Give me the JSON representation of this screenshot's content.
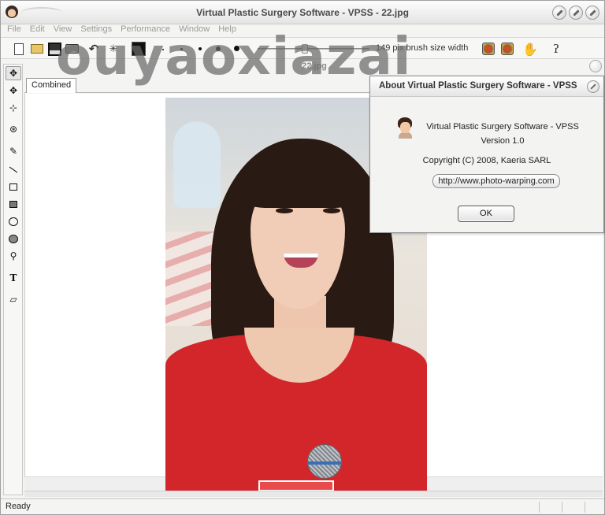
{
  "window": {
    "title": "Virtual Plastic Surgery Software - VPSS - 22.jpg"
  },
  "menu": {
    "items": [
      "File",
      "Edit",
      "View",
      "Settings",
      "Performance",
      "Window",
      "Help"
    ]
  },
  "toolbar": {
    "brush_size_label": "149 pix brush size width",
    "brush_size": 149,
    "brush_size_slider_fraction": 0.42,
    "icons": [
      "new-file-icon",
      "open-folder-icon",
      "save-icon",
      "print-icon",
      "undo-icon",
      "sparkle-icon",
      "color-swatch-icon",
      "brush-size-dots",
      "record-icon",
      "record-icon",
      "hand-icon",
      "help-icon"
    ],
    "active_color": "#111111"
  },
  "tools": {
    "icons": [
      "move-all-icon",
      "move-icon",
      "expand-icon",
      "shrink-icon",
      "pencil-icon",
      "line-icon",
      "rectangle-icon",
      "filled-rectangle-icon",
      "ellipse-icon",
      "filled-ellipse-icon",
      "eyedropper-icon",
      "text-icon",
      "eraser-icon"
    ],
    "text_tool_glyph": "T"
  },
  "document": {
    "title": "22.jpg",
    "tabs": [
      "Combined"
    ]
  },
  "watermark": {
    "text": "ouyaoxiazai"
  },
  "about_dialog": {
    "title": "About Virtual Plastic Surgery Software - VPSS",
    "app_name": "Virtual Plastic Surgery Software - VPSS",
    "version": "Version 1.0",
    "copyright": "Copyright (C) 2008, Kaeria SARL",
    "link": "http://www.photo-warping.com",
    "ok_label": "OK"
  },
  "status": {
    "text": "Ready"
  }
}
